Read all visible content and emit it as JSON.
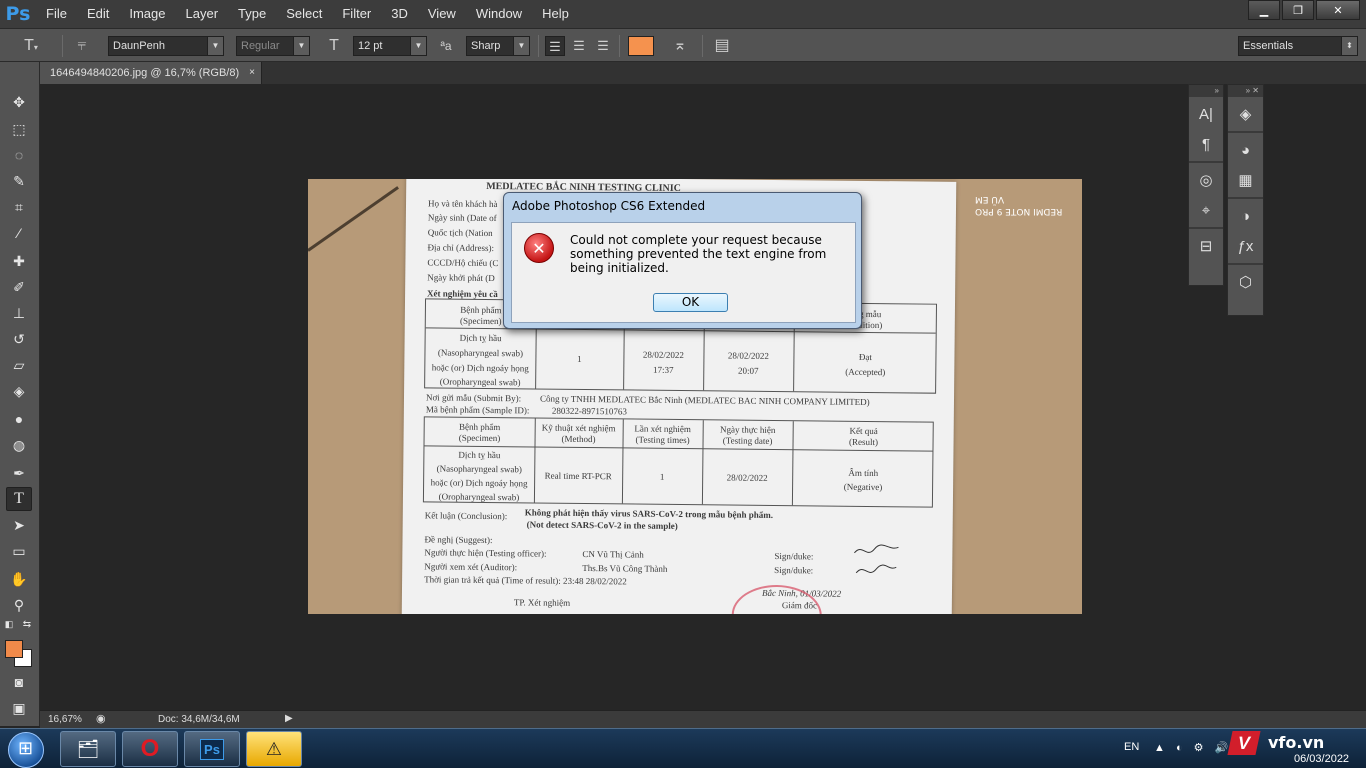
{
  "app": {
    "logo": "Ps",
    "title": "Adobe Photoshop CS6 Extended"
  },
  "menu": [
    "File",
    "Edit",
    "Image",
    "Layer",
    "Type",
    "Select",
    "Filter",
    "3D",
    "View",
    "Window",
    "Help"
  ],
  "window_controls": {
    "minimize": "▁",
    "restore": "❐",
    "close": "✕"
  },
  "options_bar": {
    "font_family": "DaunPenh",
    "font_style": "Regular",
    "font_size": "12 pt",
    "anti_alias": "Sharp",
    "aa_label": "ªa",
    "text_color": "#f5924e",
    "workspace": "Essentials"
  },
  "document_tab": {
    "title": "1646494840206.jpg @ 16,7% (RGB/8)",
    "close": "×"
  },
  "document": {
    "clinic": "MEDLATEC BẮC NINH TESTING CLINIC",
    "fields": [
      "Họ và tên khách hà",
      "Ngày sinh (Date of",
      "Quốc tịch (Nation",
      "Địa chỉ (Address):",
      "CCCD/Hộ chiếu (C",
      "Ngày khởi phát (D"
    ],
    "test_requested": "Xét nghiệm yêu cầ",
    "table1_headers": [
      "Bệnh phẩm",
      "(Specimen)",
      "",
      "",
      "",
      "ạng mẫu",
      "ondition)"
    ],
    "table1_specimen": [
      "Dịch tỵ hầu",
      "(Nasopharyngeal swab)",
      "hoặc (or) Dịch ngoáy họng",
      "(Oropharyngeal swab)"
    ],
    "table1_count": "1",
    "table1_date1": "28/02/2022",
    "table1_time1": "17:37",
    "table1_date2": "28/02/2022",
    "table1_time2": "20:07",
    "table1_condition": "Đạt",
    "table1_condition_en": "(Accepted)",
    "submitted_by": "Nơi gửi mẫu (Submit By):",
    "submitted_value": "Công ty TNHH MEDLATEC Bắc Ninh (MEDLATEC BAC NINH COMPANY LIMITED)",
    "sample_id_label": "Mã bệnh phẩm (Sample ID):",
    "sample_id": "280322-8971510763",
    "table2_headers": [
      [
        "Bệnh phẩm",
        "(Specimen)"
      ],
      [
        "Kỹ thuật xét nghiệm",
        "(Method)"
      ],
      [
        "Lần xét nghiệm",
        "(Testing times)"
      ],
      [
        "Ngày thực hiện",
        "(Testing date)"
      ],
      [
        "Kết quả",
        "(Result)"
      ]
    ],
    "table2_specimen": [
      "Dịch tỵ hầu",
      "(Nasopharyngeal swab)",
      "hoặc (or) Dịch ngoáy họng",
      "(Oropharyngeal swab)"
    ],
    "table2_method": "Real time RT-PCR",
    "table2_times": "1",
    "table2_date": "28/02/2022",
    "table2_result": "Âm tính",
    "table2_result_en": "(Negative)",
    "conclusion_label": "Kết luận (Conclusion):",
    "conclusion_vi": "Không phát hiện thấy virus SARS-CoV-2 trong mẫu bệnh phẩm.",
    "conclusion_en": "(Not detect SARS-CoV-2 in the sample)",
    "suggest": "Đề nghị (Suggest):",
    "officer_label": "Người thực hiện (Testing officer):",
    "officer": "CN Vũ Thị Cảnh",
    "auditor_label": "Người xem xét (Auditor):",
    "auditor": "Ths.Bs Vũ Công Thành",
    "sign_label": "Sign/duke:",
    "result_time": "Thời gian trả kết quả (Time of result): 23:48 28/02/2022",
    "place_date": "Bắc Ninh, 01/03/2022",
    "director": "Giám đốc",
    "dept": "TP. Xét nghiệm",
    "phone_watermark_1": "REDMI NOTE 9 PRO",
    "phone_watermark_2": "VŨ EM"
  },
  "dialog": {
    "title": "Adobe Photoshop CS6 Extended",
    "icon": "✕",
    "message": "Could not complete your request because something prevented the text engine from being initialized.",
    "ok": "OK"
  },
  "status": {
    "zoom": "16,67%",
    "doc": "Doc: 34,6M/34,6M"
  },
  "taskbar": {
    "lang": "EN",
    "date": "06/03/2022",
    "tray_icons": "▲ ◐ ⚙ 🔊",
    "watermark": "vfo.vn",
    "watermark_v": "V"
  },
  "colors": {
    "fg": "#f08a4a",
    "bg": "#ffffff",
    "ps_blue": "#3d9be9"
  }
}
